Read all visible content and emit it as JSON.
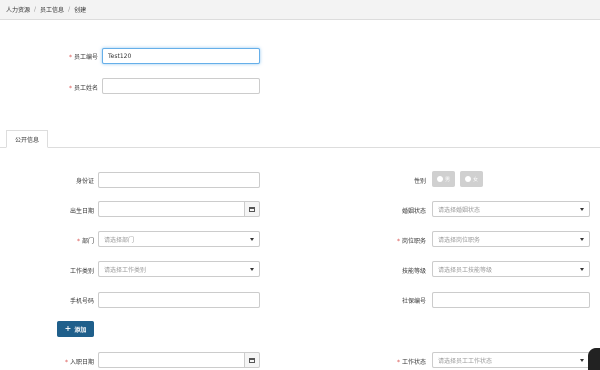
{
  "breadcrumb": {
    "items": [
      "人力资源",
      "员工信息",
      "创建"
    ],
    "separator": "/"
  },
  "fields": {
    "employee_id": {
      "label": "员工编号",
      "value": "Test120"
    },
    "employee_name": {
      "label": "员工姓名",
      "value": ""
    }
  },
  "tabs": {
    "public_info": "公开信息"
  },
  "public": {
    "id_card": {
      "label": "身份证"
    },
    "gender": {
      "label": "性别",
      "options": [
        "男",
        "女"
      ]
    },
    "birth_date": {
      "label": "出生日期"
    },
    "marital": {
      "label": "婚姻状态",
      "placeholder": "请选择婚姻状态"
    },
    "department": {
      "label": "部门",
      "placeholder": "请选择部门"
    },
    "position": {
      "label": "岗位职务",
      "placeholder": "请选择岗位职务"
    },
    "work_type": {
      "label": "工作类别",
      "placeholder": "请选择工作类别"
    },
    "tech_level": {
      "label": "技能等级",
      "placeholder": "请选择员工技能等级"
    },
    "phone": {
      "label": "手机号码"
    },
    "social_security": {
      "label": "社保编号"
    },
    "add_button": "添加",
    "hire_date": {
      "label": "入职日期"
    },
    "work_status": {
      "label": "工作状态",
      "placeholder": "请选择员工工作状态"
    }
  },
  "colors": {
    "accent": "#1f5f8b",
    "required": "#d9534f",
    "focus": "#66afe9"
  }
}
